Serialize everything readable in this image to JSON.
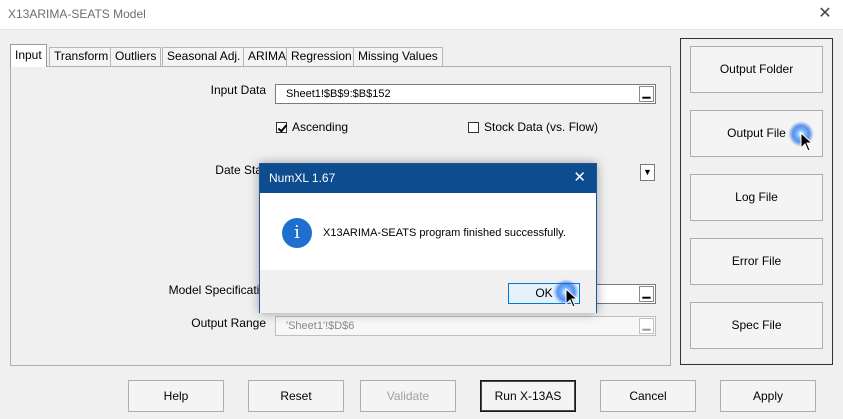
{
  "window": {
    "title": "X13ARIMA-SEATS Model",
    "close_glyph": "✕"
  },
  "tabs": [
    {
      "label": "Input",
      "active": true
    },
    {
      "label": "Transform"
    },
    {
      "label": "Outliers"
    },
    {
      "label": "Seasonal Adj."
    },
    {
      "label": "ARIMA"
    },
    {
      "label": "Regression"
    },
    {
      "label": "Missing Values"
    }
  ],
  "input": {
    "input_data_label": "Input Data",
    "input_data_value": "Sheet1!$B$9:$B$152",
    "ascending_label": "Ascending",
    "ascending_checked": true,
    "stock_label": "Stock Data (vs. Flow)",
    "stock_checked": false,
    "date_start_label": "Date Star",
    "model_spec_label": "Model Specificatio",
    "output_range_label": "Output Range",
    "output_range_value": "'Sheet1'!$D$6",
    "refedit_button_glyph": "▁",
    "combo_arrow_glyph": "▼"
  },
  "side_buttons": {
    "output_folder": "Output Folder",
    "output_file": "Output File",
    "log_file": "Log File",
    "error_file": "Error File",
    "spec_file": "Spec File"
  },
  "bottom_buttons": {
    "help": "Help",
    "reset": "Reset",
    "validate": "Validate",
    "run": "Run X-13AS",
    "cancel": "Cancel",
    "apply": "Apply"
  },
  "dialog": {
    "title": "NumXL 1.67",
    "close_glyph": "✕",
    "info_glyph": "i",
    "message": "X13ARIMA-SEATS program finished successfully.",
    "ok_label": "OK"
  },
  "colors": {
    "dialog_title_bg": "#0d4c8f",
    "info_icon": "#1f6fd1",
    "ok_focus": "#0078d7"
  }
}
